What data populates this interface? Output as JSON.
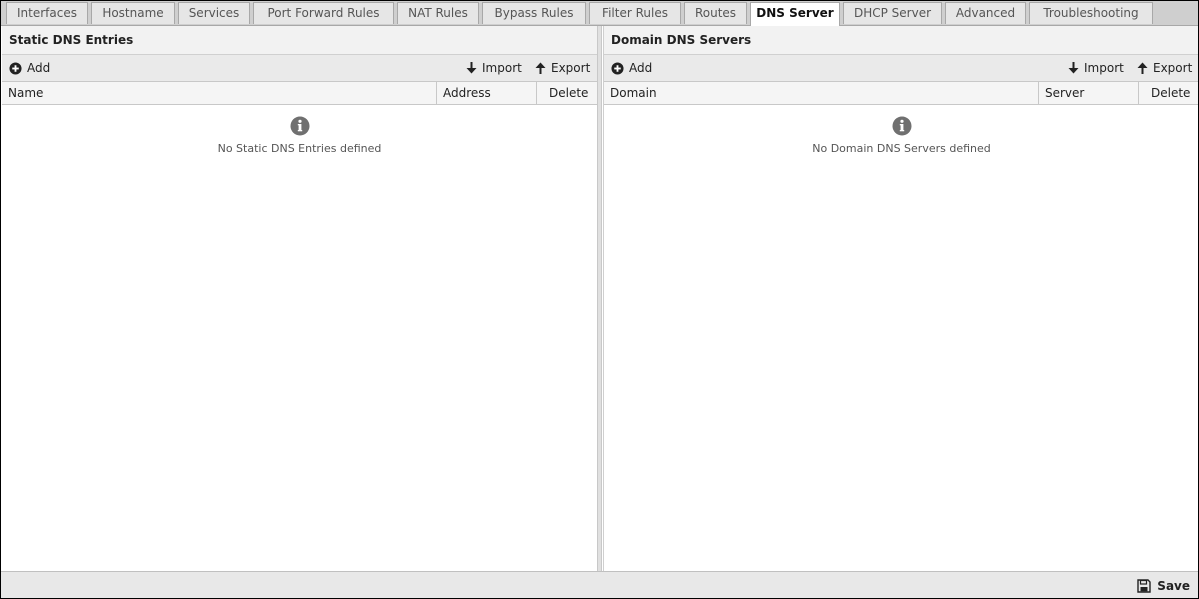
{
  "tabs": [
    {
      "label": "Interfaces"
    },
    {
      "label": "Hostname"
    },
    {
      "label": "Services"
    },
    {
      "label": "Port Forward Rules"
    },
    {
      "label": "NAT Rules"
    },
    {
      "label": "Bypass Rules"
    },
    {
      "label": "Filter Rules"
    },
    {
      "label": "Routes"
    },
    {
      "label": "DNS Server",
      "active": true
    },
    {
      "label": "DHCP Server"
    },
    {
      "label": "Advanced"
    },
    {
      "label": "Troubleshooting"
    }
  ],
  "static_dns": {
    "title": "Static DNS Entries",
    "add_label": "Add",
    "import_label": "Import",
    "export_label": "Export",
    "columns": [
      "Name",
      "Address",
      "Delete"
    ],
    "empty_message": "No Static DNS Entries defined"
  },
  "domain_dns": {
    "title": "Domain DNS Servers",
    "add_label": "Add",
    "import_label": "Import",
    "export_label": "Export",
    "columns": [
      "Domain",
      "Server",
      "Delete"
    ],
    "empty_message": "No Domain DNS Servers defined"
  },
  "footer": {
    "save_label": "Save"
  },
  "icons": {
    "add": "plus-circle-icon",
    "import": "arrow-down-icon",
    "export": "arrow-up-icon",
    "empty": "info-circle-icon",
    "save": "floppy-disk-icon"
  }
}
